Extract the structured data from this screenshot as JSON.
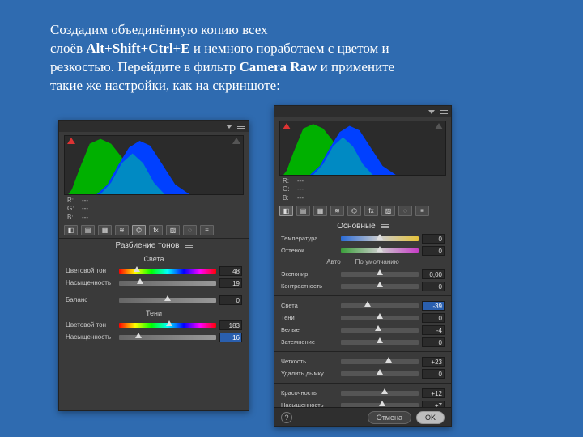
{
  "instruction": {
    "line1a": "Создадим объединённую копию всех",
    "line2a": "слоёв ",
    "shortcut": "Alt+Shift+Ctrl+E",
    "line2b": " и немного поработаем с цветом и",
    "line3a": "резкостью. Перейдите в фильтр ",
    "filter": "Camera Raw",
    "line3b": " и примените",
    "line4": "такие же настройки, как на скриншоте:"
  },
  "rgb": {
    "r": "R:",
    "g": "G:",
    "b": "B:",
    "dash": "---"
  },
  "tabs": [
    "◧",
    "▤",
    "▦",
    "≋",
    "⌬",
    "fx",
    "▨",
    "◌",
    "≡"
  ],
  "left": {
    "panel_title": "Разбиение тонов",
    "group_highlights": "Света",
    "group_shadows": "Тени",
    "rows": {
      "hue1": {
        "label": "Цветовой тон",
        "value": "48",
        "pos": 18
      },
      "sat1": {
        "label": "Насыщенность",
        "value": "19",
        "pos": 22
      },
      "balance": {
        "label": "Баланс",
        "value": "0",
        "pos": 50
      },
      "hue2": {
        "label": "Цветовой тон",
        "value": "183",
        "pos": 52
      },
      "sat2": {
        "label": "Насыщенность",
        "value": "16",
        "pos": 20,
        "hilite": true
      }
    }
  },
  "right": {
    "panel_title": "Основные",
    "auto": "Авто",
    "default": "По умолчанию",
    "rows": {
      "temperature": {
        "label": "Температура",
        "value": "0",
        "pos": 50,
        "track": "temp"
      },
      "tint": {
        "label": "Оттенок",
        "value": "0",
        "pos": 50,
        "track": "tint"
      },
      "exposure": {
        "label": "Экспонир",
        "value": "0,00",
        "pos": 50
      },
      "contrast": {
        "label": "Контрастность",
        "value": "0",
        "pos": 50
      },
      "highlights": {
        "label": "Света",
        "value": "-39",
        "pos": 34,
        "hilite": true
      },
      "shadows": {
        "label": "Тени",
        "value": "0",
        "pos": 50
      },
      "whites": {
        "label": "Белые",
        "value": "-4",
        "pos": 48
      },
      "blacks": {
        "label": "Затемнение",
        "value": "0",
        "pos": 50
      },
      "clarity": {
        "label": "Четкость",
        "value": "+23",
        "pos": 61
      },
      "dehaze": {
        "label": "Удалить дымку",
        "value": "0",
        "pos": 50
      },
      "vibrance": {
        "label": "Красочность",
        "value": "+12",
        "pos": 56
      },
      "saturation": {
        "label": "Насыщенность",
        "value": "+7",
        "pos": 53
      }
    },
    "cancel": "Отмена",
    "ok": "OK"
  }
}
